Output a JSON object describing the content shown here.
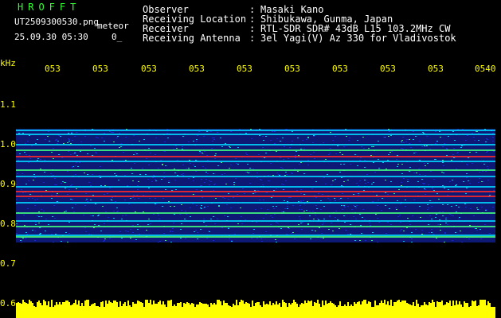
{
  "header": {
    "brand": "HROFFT",
    "filename": "UT2509300530.png",
    "tag": "meteor",
    "datetime": "25.09.30 05:30",
    "extra": "0_"
  },
  "info": {
    "labels": [
      "Observer",
      "Receiving Location",
      "Receiver",
      "Receiving Antenna"
    ],
    "values": [
      "Masaki Kano",
      "Shibukawa, Gunma, Japan",
      "RTL-SDR SDR# 43dB L15 103.2MHz CW",
      "3el Yagi(V) Az 330 for Vladivostok"
    ]
  },
  "axes": {
    "y_unit": "kHz",
    "y_ticks": [
      "1.1",
      "1.0",
      "0.9",
      "0.8",
      "0.7",
      "0.6"
    ],
    "x_ticks": [
      "053",
      "053",
      "053",
      "053",
      "053",
      "053",
      "053",
      "053",
      "053",
      "0540"
    ]
  },
  "spectrogram": {
    "colors": {
      "background": "#000000",
      "noise": "#1a2bd6",
      "line": "#00d8ff",
      "strong": "#ff2a2a",
      "mid": "#40ff80",
      "amplitude": "#ffff00"
    }
  }
}
